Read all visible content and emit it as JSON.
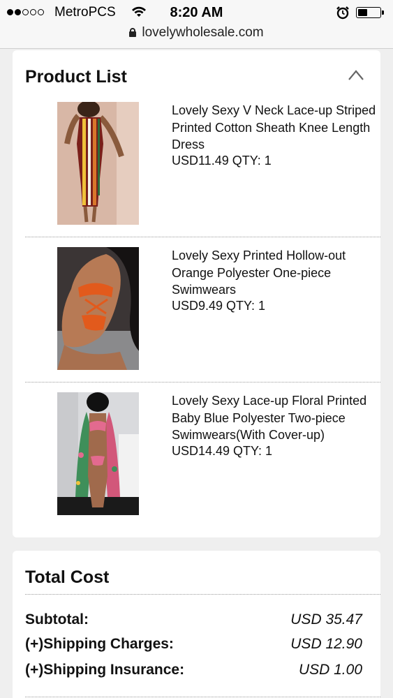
{
  "status_bar": {
    "carrier": "MetroPCS",
    "time": "8:20 AM",
    "signal_bars": 2,
    "battery_level": 0.45
  },
  "browser": {
    "url": "lovelywholesale.com"
  },
  "product_list": {
    "title": "Product List",
    "items": [
      {
        "name": "Lovely Sexy V Neck Lace-up Striped Printed Cotton Sheath Knee Length Dress",
        "price_qty": "USD11.49 QTY: 1"
      },
      {
        "name": "Lovely Sexy Printed Hollow-out Orange Polyester One-piece Swimwears",
        "price_qty": "USD9.49 QTY: 1"
      },
      {
        "name": "Lovely Sexy Lace-up Floral Printed Baby Blue Polyester Two-piece Swimwears(With Cover-up)",
        "price_qty": "USD14.49 QTY: 1"
      }
    ]
  },
  "total_cost": {
    "title": "Total Cost",
    "rows": [
      {
        "label": "Subtotal:",
        "value": "USD 35.47"
      },
      {
        "label": "(+)Shipping Charges:",
        "value": "USD 12.90"
      },
      {
        "label": "(+)Shipping Insurance:",
        "value": "USD 1.00"
      }
    ]
  },
  "colors": {
    "page_background": "#efefef",
    "card_background": "#ffffff",
    "separator": "#9a9a9a"
  }
}
